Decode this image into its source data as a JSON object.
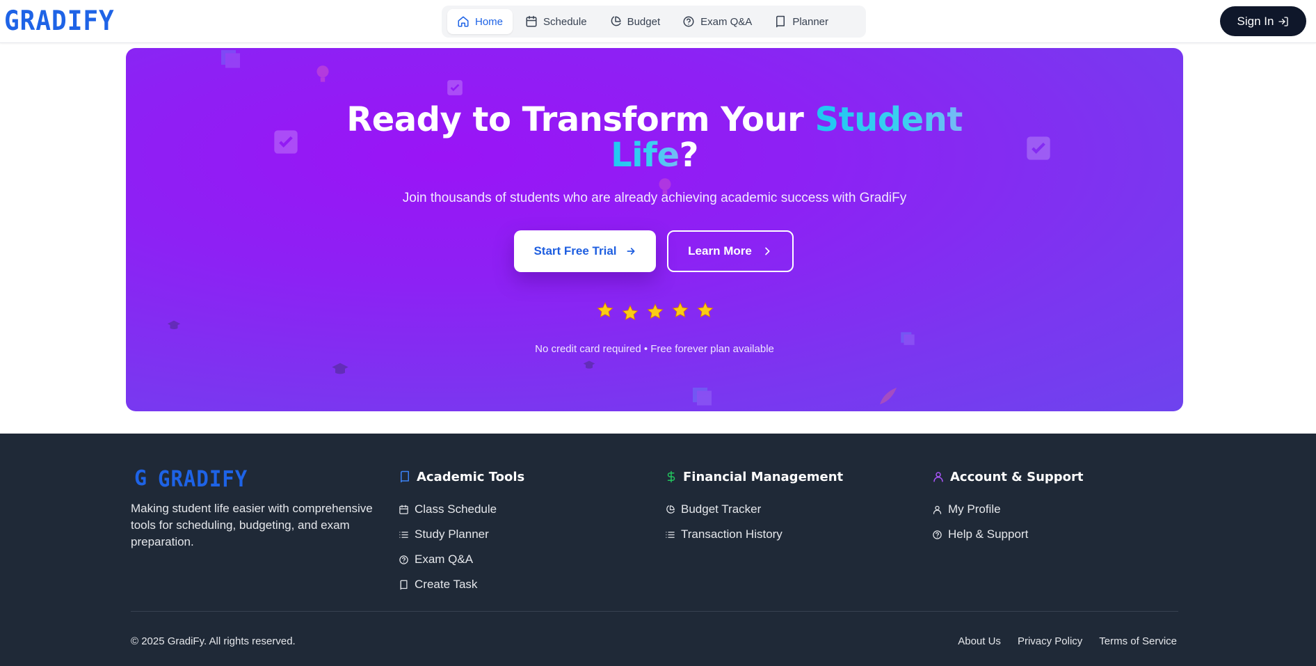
{
  "brand": {
    "name": "GRADIFY",
    "footer_name": "GRADIFY",
    "footer_mark": "G",
    "color": "#1e63e6"
  },
  "nav": {
    "tabs": [
      {
        "label": "Home",
        "icon": "home-icon",
        "active": true
      },
      {
        "label": "Schedule",
        "icon": "calendar-icon",
        "active": false
      },
      {
        "label": "Budget",
        "icon": "pie-chart-icon",
        "active": false
      },
      {
        "label": "Exam Q&A",
        "icon": "help-circle-icon",
        "active": false
      },
      {
        "label": "Planner",
        "icon": "book-icon",
        "active": false
      }
    ],
    "signin_label": "Sign In"
  },
  "hero": {
    "title_part1": "Ready to Transform Your ",
    "title_accent1": "Student",
    "title_accent2": "Life",
    "title_end": "?",
    "subtitle": "Join thousands of students who are already achieving academic success with GradiFy",
    "primary_button": "Start Free Trial",
    "secondary_button": "Learn More",
    "rating_stars": 5,
    "note": "No credit card required • Free forever plan available"
  },
  "footer": {
    "description": "Making student life easier with comprehensive tools for scheduling, budgeting, and exam preparation.",
    "columns": [
      {
        "title": "Academic Tools",
        "icon": "book-icon",
        "icon_color": "#3b82f6",
        "links": [
          {
            "label": "Class Schedule",
            "icon": "calendar-icon"
          },
          {
            "label": "Study Planner",
            "icon": "list-icon"
          },
          {
            "label": "Exam Q&A",
            "icon": "help-circle-icon"
          },
          {
            "label": "Create Task",
            "icon": "book-icon"
          }
        ]
      },
      {
        "title": "Financial Management",
        "icon": "dollar-icon",
        "icon_color": "#22c55e",
        "links": [
          {
            "label": "Budget Tracker",
            "icon": "pie-chart-icon"
          },
          {
            "label": "Transaction History",
            "icon": "list-icon"
          }
        ]
      },
      {
        "title": "Account & Support",
        "icon": "user-icon",
        "icon_color": "#a855f7",
        "links": [
          {
            "label": "My Profile",
            "icon": "user-icon"
          },
          {
            "label": "Help & Support",
            "icon": "help-circle-icon"
          }
        ]
      }
    ],
    "copyright": "© 2025 GradiFy. All rights reserved.",
    "bottom_links": [
      "About Us",
      "Privacy Policy",
      "Terms of Service"
    ]
  }
}
